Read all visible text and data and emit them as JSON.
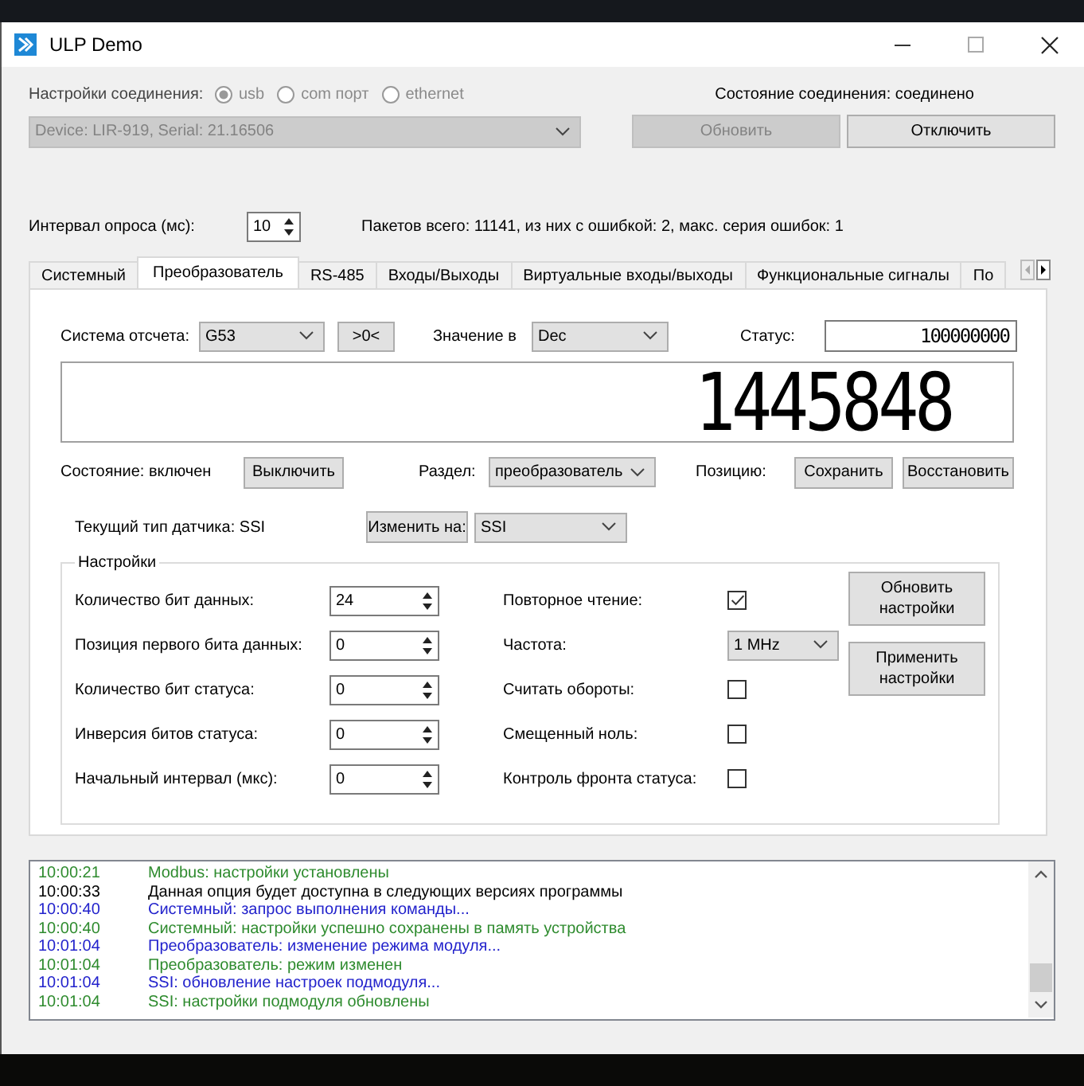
{
  "window": {
    "title": "ULP Demo"
  },
  "connection": {
    "label": "Настройки соединения:",
    "disabled": true,
    "options": [
      {
        "label": "usb",
        "selected": true
      },
      {
        "label": "com порт",
        "selected": false
      },
      {
        "label": "ethernet",
        "selected": false
      }
    ],
    "status": "Состояние соединения: соединено",
    "device": "Device: LIR-919, Serial: 21.16506",
    "buttons": [
      {
        "label": "Обновить",
        "disabled": true
      },
      {
        "label": "Отключить",
        "disabled": false
      }
    ]
  },
  "polling": {
    "label": "Интервал опроса (мс):",
    "value": "10",
    "stats": "Пакетов всего: 11141, из них с ошибкой: 2, макс. серия ошибок: 1"
  },
  "tabs": [
    {
      "label": "Системный",
      "selected": false
    },
    {
      "label": "Преобразователь",
      "selected": true
    },
    {
      "label": "RS-485",
      "selected": false
    },
    {
      "label": "Входы/Выходы",
      "selected": false
    },
    {
      "label": "Виртуальные входы/выходы",
      "selected": false
    },
    {
      "label": "Функциональные сигналы",
      "selected": false
    },
    {
      "label": "По",
      "selected": false
    }
  ],
  "converter": {
    "reference_label": "Система отсчета:",
    "reference": "G53",
    "zero_button": ">0<",
    "value_label": "Значение в",
    "value_format": "Dec",
    "status_label": "Статус:",
    "status": "100000000",
    "display": "1445848",
    "state": "Состояние: включен",
    "toggle_button": "Выключить",
    "section_label": "Раздел:",
    "section": "преобразователь",
    "position_label": "Позицию:",
    "save_button": "Сохранить",
    "restore_button": "Восстановить",
    "sensor_type": "Текущий тип датчика: SSI",
    "change_button": "Изменить на:",
    "sensor_choice": "SSI"
  },
  "settings": {
    "title": "Настройки",
    "fields": [
      {
        "label": "Количество бит данных:",
        "value": "24"
      },
      {
        "label": "Позиция первого бита данных:",
        "value": "0"
      },
      {
        "label": "Количество бит статуса:",
        "value": "0"
      },
      {
        "label": "Инверсия битов статуса:",
        "value": "0"
      },
      {
        "label": "Начальный интервал (мкс):",
        "value": "0"
      }
    ],
    "options": [
      {
        "label": "Повторное чтение:",
        "kind": "checkbox",
        "checked": true
      },
      {
        "label": "Частота:",
        "kind": "select",
        "value": "1 MHz"
      },
      {
        "label": "Считать обороты:",
        "kind": "checkbox",
        "checked": false
      },
      {
        "label": "Смещенный ноль:",
        "kind": "checkbox",
        "checked": false
      },
      {
        "label": "Контроль фронта статуса:",
        "kind": "checkbox",
        "checked": false
      }
    ],
    "buttons": [
      "Обновить настройки",
      "Применить настройки"
    ]
  },
  "log": [
    {
      "time": "10:00:21",
      "text": "Modbus:  настройки установлены",
      "color": "#2e8b2e"
    },
    {
      "time": "10:00:33",
      "text": "Данная опция будет доступна в следующих версиях программы",
      "color": "#000000"
    },
    {
      "time": "10:00:40",
      "text": "Системный:  запрос выполнения команды...",
      "color": "#2222cc"
    },
    {
      "time": "10:00:40",
      "text": "Системный:  настройки успешно сохранены в память устройства",
      "color": "#2e8b2e"
    },
    {
      "time": "10:01:04",
      "text": "Преобразователь:  изменение режима модуля...",
      "color": "#2222cc"
    },
    {
      "time": "10:01:04",
      "text": "Преобразователь:  режим изменен",
      "color": "#2e8b2e"
    },
    {
      "time": "10:01:04",
      "text": "SSI:  обновление настроек подмодуля...",
      "color": "#2222cc"
    },
    {
      "time": "10:01:04",
      "text": "SSI:  настройки подмодуля обновлены",
      "color": "#2e8b2e"
    }
  ]
}
